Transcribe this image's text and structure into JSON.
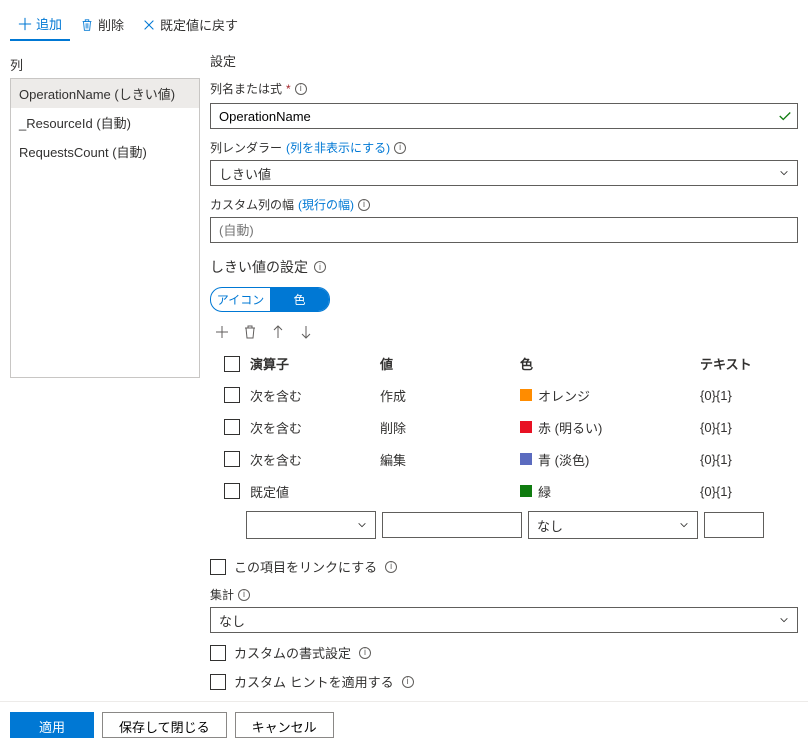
{
  "toolbar": {
    "add": "追加",
    "delete": "削除",
    "reset": "既定値に戻す"
  },
  "left": {
    "title": "列",
    "items": [
      {
        "label": "OperationName (しきい値)",
        "selected": true
      },
      {
        "label": "_ResourceId (自動)",
        "selected": false
      },
      {
        "label": "RequestsCount (自動)",
        "selected": false
      }
    ]
  },
  "settings": {
    "title": "設定",
    "columnExp": {
      "label": "列名または式",
      "value": "OperationName"
    },
    "renderer": {
      "label": "列レンダラー",
      "link": "(列を非表示にする)",
      "value": "しきい値"
    },
    "customWidth": {
      "label": "カスタム列の幅",
      "link": "(現行の幅)",
      "placeholder": "(自動)",
      "value": ""
    },
    "threshold": {
      "title": "しきい値の設定",
      "toggle": {
        "left": "アイコン",
        "right": "色",
        "active": "right"
      },
      "headers": {
        "op": "演算子",
        "val": "値",
        "color": "色",
        "text": "テキスト"
      },
      "rows": [
        {
          "op": "次を含む",
          "val": "作成",
          "colorHex": "#ff8c00",
          "colorName": "オレンジ",
          "text": "{0}{1}"
        },
        {
          "op": "次を含む",
          "val": "削除",
          "colorHex": "#e81123",
          "colorName": "赤 (明るい)",
          "text": "{0}{1}"
        },
        {
          "op": "次を含む",
          "val": "編集",
          "colorHex": "#5b6bbf",
          "colorName": "青 (淡色)",
          "text": "{0}{1}"
        },
        {
          "op": "既定値",
          "val": "",
          "colorHex": "#107c10",
          "colorName": "緑",
          "text": "{0}{1}"
        }
      ],
      "inputRow": {
        "op": "",
        "val": "",
        "color": "なし",
        "text": ""
      }
    },
    "linkItem": "この項目をリンクにする",
    "aggregation": {
      "label": "集計",
      "value": "なし"
    },
    "customFormat": "カスタムの書式設定",
    "customHint": "カスタム ヒントを適用する"
  },
  "footer": {
    "apply": "適用",
    "saveClose": "保存して閉じる",
    "cancel": "キャンセル"
  }
}
